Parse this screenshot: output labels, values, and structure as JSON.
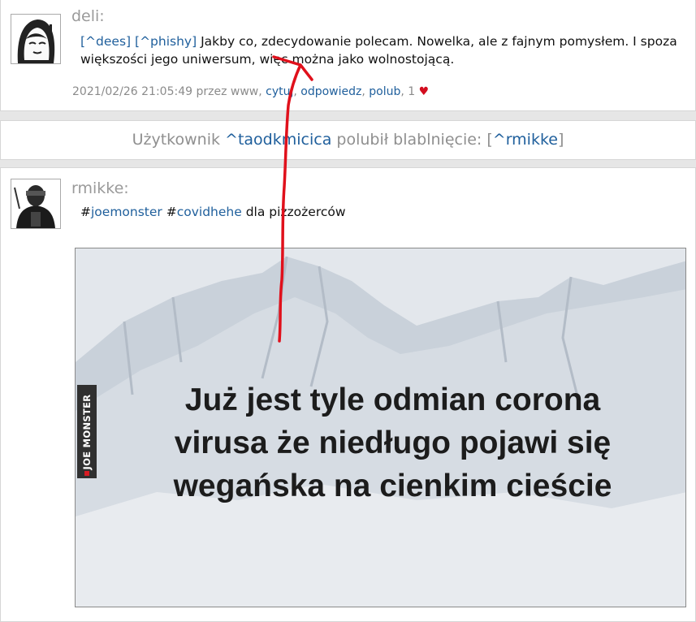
{
  "post1": {
    "author": "deli:",
    "mention1": "[^dees]",
    "mention2": "[^phishy]",
    "text": "Jakby co, zdecydowanie polecam. Nowelka, ale z fajnym pomysłem. I spoza większości jego uniwersum, więc można jako wolnostojącą.",
    "meta": {
      "prefix": "2021/02/26 21:05:49 przez www,",
      "quote": "cytuj",
      "reply": "odpowiedz",
      "like": "polub",
      "like_count": ", 1",
      "heart": "♥"
    }
  },
  "notice": {
    "prefix": "Użytkownik",
    "user": "^taodkmicica",
    "middle": "polubił blablnięcie: [",
    "target": "^rmikke",
    "suffix": "]"
  },
  "post2": {
    "author": "rmikke:",
    "hash1": "#",
    "tag1": "joemonster",
    "hash2": " #",
    "tag2": "covidhehe",
    "text": " dla pizzożerców",
    "image": {
      "watermark": "JOE MONSTER",
      "caption": [
        "Już jest tyle odmian corona",
        "virusa że niedługo pojawi się",
        "wegańska na cienkim cieście"
      ]
    }
  },
  "annotation": {
    "color": "#e0101b"
  }
}
